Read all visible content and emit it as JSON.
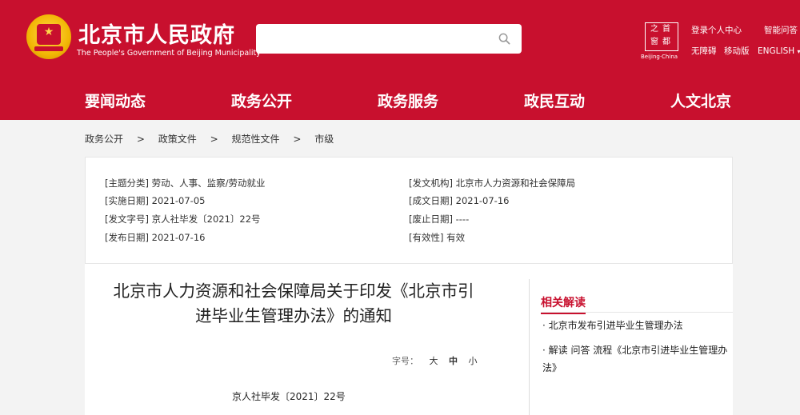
{
  "header": {
    "site_title": "北京市人民政府",
    "site_subtitle": "The People's Government of Beijing Municipality",
    "search": {
      "value": "",
      "placeholder": ""
    },
    "seal": {
      "chars": [
        "首",
        "都",
        "之",
        "窗"
      ],
      "caption": "Beijing·China"
    },
    "links": {
      "login": "登录个人中心",
      "ai_qa": "智能问答",
      "accessibility": "无障碍",
      "mobile": "移动版",
      "english": "ENGLISH",
      "english_arrow": "▾"
    }
  },
  "nav": {
    "items": [
      {
        "label": "要闻动态"
      },
      {
        "label": "政务公开"
      },
      {
        "label": "政务服务"
      },
      {
        "label": "政民互动"
      },
      {
        "label": "人文北京"
      }
    ]
  },
  "breadcrumb": {
    "items": [
      "政务公开",
      "政策文件",
      "规范性文件",
      "市级"
    ],
    "separator": ">"
  },
  "meta": {
    "topic": "[主题分类] 劳动、人事、监察/劳动就业",
    "issuer": "[发文机构] 北京市人力资源和社会保障局",
    "effective_date": "[实施日期] 2021-07-05",
    "written_date": "[成文日期] 2021-07-16",
    "doc_no": "[发文字号] 京人社毕发〔2021〕22号",
    "abolished_date": "[废止日期] ----",
    "publish_date": "[发布日期] 2021-07-16",
    "validity": "[有效性] 有效"
  },
  "document": {
    "title_line1": "北京市人力资源和社会保障局关于印发《北京市引",
    "title_line2": "进毕业生管理办法》的通知",
    "font_size": {
      "label": "字号：",
      "large": "大",
      "medium": "中",
      "small": "小"
    },
    "doc_number": "京人社毕发〔2021〕22号"
  },
  "related": {
    "title": "相关解读",
    "links": [
      {
        "text": "· 北京市发布引进毕业生管理办法"
      },
      {
        "text": "· 解读 问答 流程《北京市引进毕业生管理办法》"
      }
    ]
  },
  "colors": {
    "brand_red": "#c8102e",
    "emblem_gold": "#f2b705"
  }
}
